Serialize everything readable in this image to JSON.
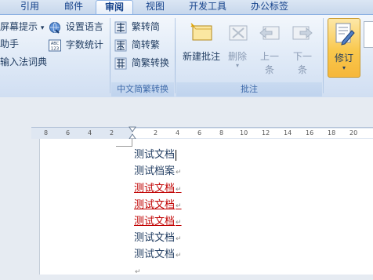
{
  "tabs": [
    "引用",
    "邮件",
    "审阅",
    "视图",
    "开发工具",
    "办公标签"
  ],
  "active_tab": "审阅",
  "proofing": {
    "item1": "屏幕提示",
    "item1_arrow": "▾",
    "item2": "助手",
    "item3": "输入法词典",
    "set_language": "设置语言",
    "word_count": "字数统计",
    "abc_label": "ABC",
    "abc_num": "123"
  },
  "chinese_conversion": {
    "to_simplified": "繁转简",
    "to_traditional": "简转繁",
    "convert": "简繁转换",
    "group_label": "中文简繁转换"
  },
  "comments": {
    "new_comment": "新建批注",
    "delete": "删除",
    "previous": [
      "上一",
      "条"
    ],
    "next": [
      "下一",
      "条"
    ],
    "group_label": "批注"
  },
  "tracking": {
    "track_changes": "修订"
  },
  "ruler_numbers": [
    "8",
    "6",
    "4",
    "2",
    "2",
    "4",
    "6",
    "8",
    "10",
    "12",
    "14",
    "16",
    "18",
    "20"
  ],
  "document_lines": [
    {
      "text": "测试文档",
      "inserted": false,
      "caret": true
    },
    {
      "text": "测试档案",
      "inserted": false
    },
    {
      "text": "测试文档",
      "inserted": true
    },
    {
      "text": "测试文档",
      "inserted": true
    },
    {
      "text": "测试文档",
      "inserted": true
    },
    {
      "text": "测试文档",
      "inserted": false
    },
    {
      "text": "测试文档",
      "inserted": false
    },
    {
      "text": "",
      "inserted": false
    }
  ],
  "paragraph_mark": "↵",
  "colors": {
    "insertion": "#c00000",
    "ribbon_text": "#15428b",
    "active_button": "#f9c84d"
  }
}
